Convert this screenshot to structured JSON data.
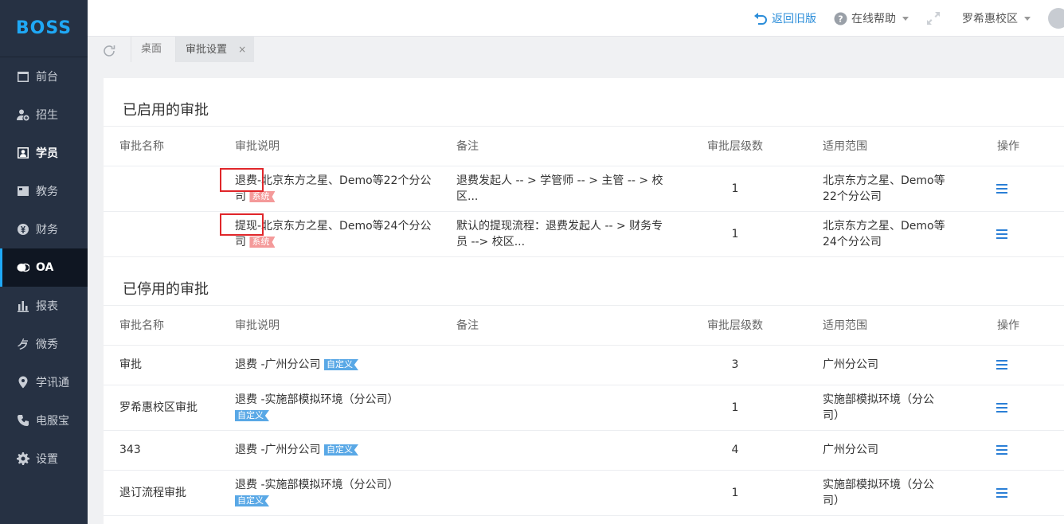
{
  "logo": "BOSS",
  "sidebar": {
    "items": [
      {
        "label": "前台",
        "icon": "calendar-icon"
      },
      {
        "label": "招生",
        "icon": "user-add-icon"
      },
      {
        "label": "学员",
        "icon": "student-icon"
      },
      {
        "label": "教务",
        "icon": "book-icon"
      },
      {
        "label": "财务",
        "icon": "yen-icon"
      },
      {
        "label": "OA",
        "icon": "chat-bubbles-icon"
      },
      {
        "label": "报表",
        "icon": "bar-chart-icon"
      },
      {
        "label": "微秀",
        "icon": "xiu-icon"
      },
      {
        "label": "学讯通",
        "icon": "location-pin-icon"
      },
      {
        "label": "电服宝",
        "icon": "phone-icon"
      },
      {
        "label": "设置",
        "icon": "gear-icon"
      }
    ],
    "active": "OA"
  },
  "topbar": {
    "back_label": "返回旧版",
    "help_label": "在线帮助",
    "campus_label": "罗希惠校区"
  },
  "tabs": {
    "desk": "桌面",
    "current": "审批设置",
    "close": "×"
  },
  "enabled": {
    "title": "已启用的审批",
    "headers": [
      "审批名称",
      "审批说明",
      "备注",
      "审批层级数",
      "适用范围",
      "操作"
    ],
    "rows": [
      {
        "name": "",
        "desc_strong": "退费",
        "desc_rest": "-北京东方之星、Demo等22个分公司",
        "tag": "系统",
        "note": "退费发起人 -- > 学管师 -- > 主管 -- > 校区...",
        "level": "1",
        "scope": "北京东方之星、Demo等22个分公司"
      },
      {
        "name": "",
        "desc_strong": "提现",
        "desc_rest": "-北京东方之星、Demo等24个分公司",
        "tag": "系统",
        "note": "默认的提现流程：退费发起人 -- > 财务专员 --> 校区...",
        "level": "1",
        "scope": "北京东方之星、Demo等24个分公司"
      }
    ]
  },
  "disabled": {
    "title": "已停用的审批",
    "headers": [
      "审批名称",
      "审批说明",
      "备注",
      "审批层级数",
      "适用范围",
      "操作"
    ],
    "rows": [
      {
        "name": "审批",
        "desc": "退费 -广州分公司",
        "tag": "自定义",
        "note": "",
        "level": "3",
        "scope": "广州分公司"
      },
      {
        "name": "罗希惠校区审批",
        "desc": "退费 -实施部模拟环境（分公司）",
        "tag": "自定义",
        "note": "",
        "level": "1",
        "scope": "实施部模拟环境（分公司）"
      },
      {
        "name": "343",
        "desc": "退费 -广州分公司",
        "tag": "自定义",
        "note": "",
        "level": "4",
        "scope": "广州分公司"
      },
      {
        "name": "退订流程审批",
        "desc": "退费 -实施部模拟环境（分公司）",
        "tag": "自定义",
        "note": "",
        "level": "1",
        "scope": "实施部模拟环境（分公司）"
      }
    ]
  },
  "colors": {
    "sidebar_bg": "#263143",
    "accent": "#1fa8f5",
    "link_blue": "#2b8dd9",
    "highlight_box": "#e0262a",
    "tag_system": "#f49a9a",
    "tag_custom": "#59a8e6"
  }
}
